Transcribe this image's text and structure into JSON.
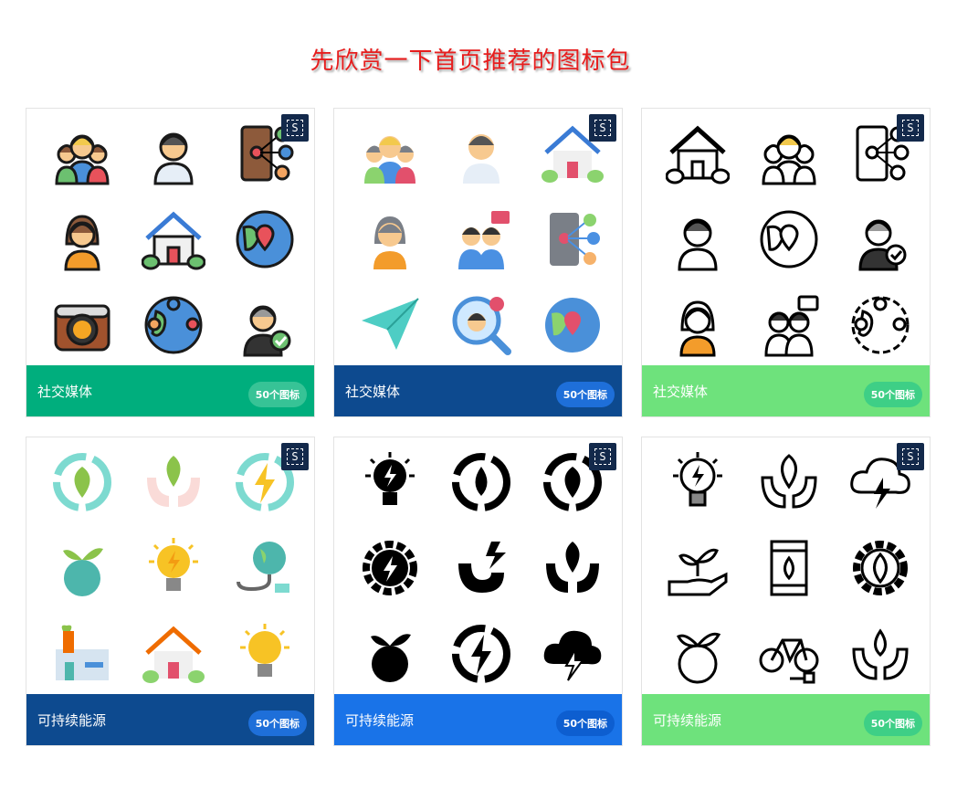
{
  "header": {
    "title": "先欣赏一下首页推荐的图标包"
  },
  "badge_label": "S",
  "cards": [
    {
      "title": "社交媒体",
      "count": "50个图标",
      "footer_color": "#00ae7d",
      "pill_color": "#37c396",
      "icons": [
        "family-group-icon",
        "young-man-icon",
        "smartphone-network-icon",
        "woman-avatar-icon",
        "house-icon",
        "globe-location-icon",
        "camera-icon",
        "globe-network-icon",
        "verified-user-icon"
      ],
      "style": "color"
    },
    {
      "title": "社交媒体",
      "count": "50个图标",
      "footer_color": "#0d4a8f",
      "pill_color": "#1e6fd9",
      "icons": [
        "family-group-icon",
        "young-man-icon",
        "house-icon",
        "woman-avatar-icon",
        "couple-like-icon",
        "smartphone-network-icon",
        "paper-plane-icon",
        "magnifier-user-icon",
        "map-location-icon"
      ],
      "style": "flat"
    },
    {
      "title": "社交媒体",
      "count": "50个图标",
      "footer_color": "#6ee27c",
      "pill_color": "#3ecf86",
      "icons": [
        "house-icon",
        "family-group-icon",
        "smartphone-network-icon",
        "young-man-icon",
        "globe-location-icon",
        "verified-user-icon",
        "woman-avatar-icon",
        "couple-like-icon",
        "globe-network-icon"
      ],
      "style": "line"
    },
    {
      "title": "可持续能源",
      "count": "50个图标",
      "footer_color": "#0d4a8f",
      "pill_color": "#1e6fd9",
      "icons": [
        "recycle-leaf-icon",
        "hands-leaf-icon",
        "recycle-bolt-icon",
        "globe-sprout-icon",
        "light-bulb-bolt-icon",
        "globe-plug-icon",
        "factory-icon",
        "eco-house-icon",
        "light-bulb-icon"
      ],
      "style": "flat"
    },
    {
      "title": "可持续能源",
      "count": "50个图标",
      "footer_color": "#1973e8",
      "pill_color": "#0d5ed0",
      "icons": [
        "light-bulb-bolt-icon",
        "recycle-drop-icon",
        "recycle-leaf-icon",
        "gear-bolt-icon",
        "magnet-icon",
        "hands-leaf-icon",
        "sprout-globe-icon",
        "recycle-bolt-icon",
        "cloud-bolt-icon"
      ],
      "style": "glyph"
    },
    {
      "title": "可持续能源",
      "count": "50个图标",
      "footer_color": "#6ee27c",
      "pill_color": "#3ecf86",
      "icons": [
        "light-bulb-bolt-icon",
        "hands-leaf-icon",
        "cloud-bolt-icon",
        "hand-sprout-icon",
        "oil-barrel-icon",
        "gear-leaf-icon",
        "sprout-globe-icon",
        "bicycle-plug-icon",
        "hands-drop-icon"
      ],
      "style": "line"
    }
  ]
}
